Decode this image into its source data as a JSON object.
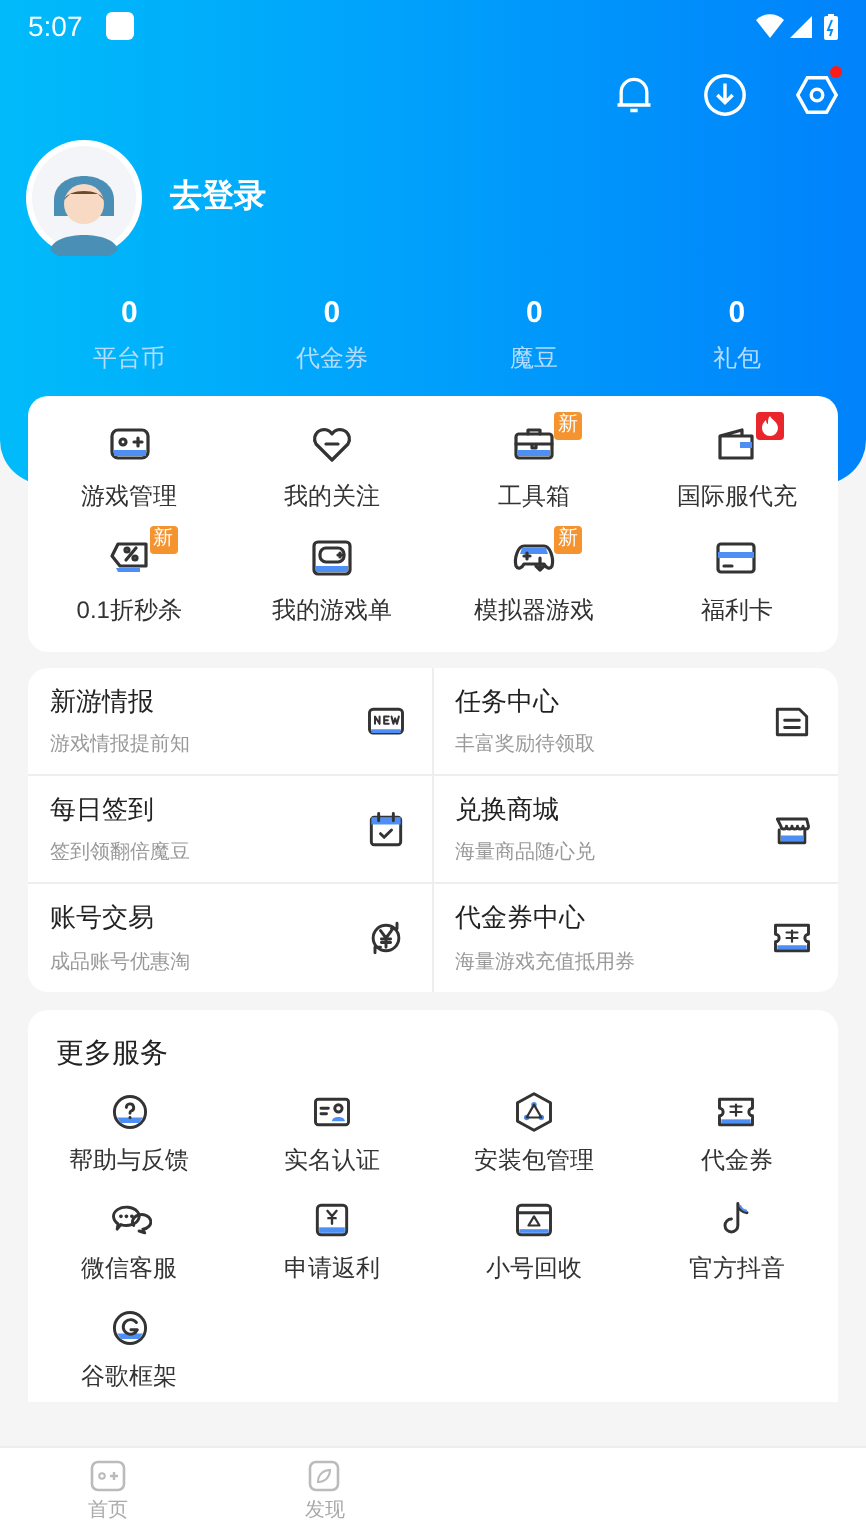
{
  "status_bar": {
    "time": "5:07"
  },
  "header": {
    "settings_dot": true,
    "login_label": "去登录"
  },
  "stats": [
    {
      "value": "0",
      "label": "平台币"
    },
    {
      "value": "0",
      "label": "代金券"
    },
    {
      "value": "0",
      "label": "魔豆"
    },
    {
      "value": "0",
      "label": "礼包"
    }
  ],
  "quick_menu": [
    {
      "label": "游戏管理"
    },
    {
      "label": "我的关注"
    },
    {
      "label": "工具箱",
      "badge": {
        "kind": "text",
        "text": "新"
      }
    },
    {
      "label": "国际服代充",
      "badge": {
        "kind": "hot"
      }
    },
    {
      "label": "0.1折秒杀",
      "badge": {
        "kind": "text",
        "text": "新"
      }
    },
    {
      "label": "我的游戏单"
    },
    {
      "label": "模拟器游戏",
      "badge": {
        "kind": "text",
        "text": "新"
      }
    },
    {
      "label": "福利卡"
    }
  ],
  "features": [
    {
      "title": "新游情报",
      "subtitle": "游戏情报提前知"
    },
    {
      "title": "任务中心",
      "subtitle": "丰富奖励待领取"
    },
    {
      "title": "每日签到",
      "subtitle": "签到领翻倍魔豆"
    },
    {
      "title": "兑换商城",
      "subtitle": "海量商品随心兑"
    },
    {
      "title": "账号交易",
      "subtitle": "成品账号优惠淘"
    },
    {
      "title": "代金券中心",
      "subtitle": "海量游戏充值抵用券"
    }
  ],
  "more_services": {
    "title": "更多服务",
    "items": [
      {
        "label": "帮助与反馈"
      },
      {
        "label": "实名认证"
      },
      {
        "label": "安装包管理"
      },
      {
        "label": "代金券"
      },
      {
        "label": "微信客服"
      },
      {
        "label": "申请返利"
      },
      {
        "label": "小号回收"
      },
      {
        "label": "官方抖音"
      },
      {
        "label": "谷歌框架"
      }
    ]
  },
  "bottom_nav": [
    {
      "label": "首页"
    },
    {
      "label": "发现"
    }
  ]
}
